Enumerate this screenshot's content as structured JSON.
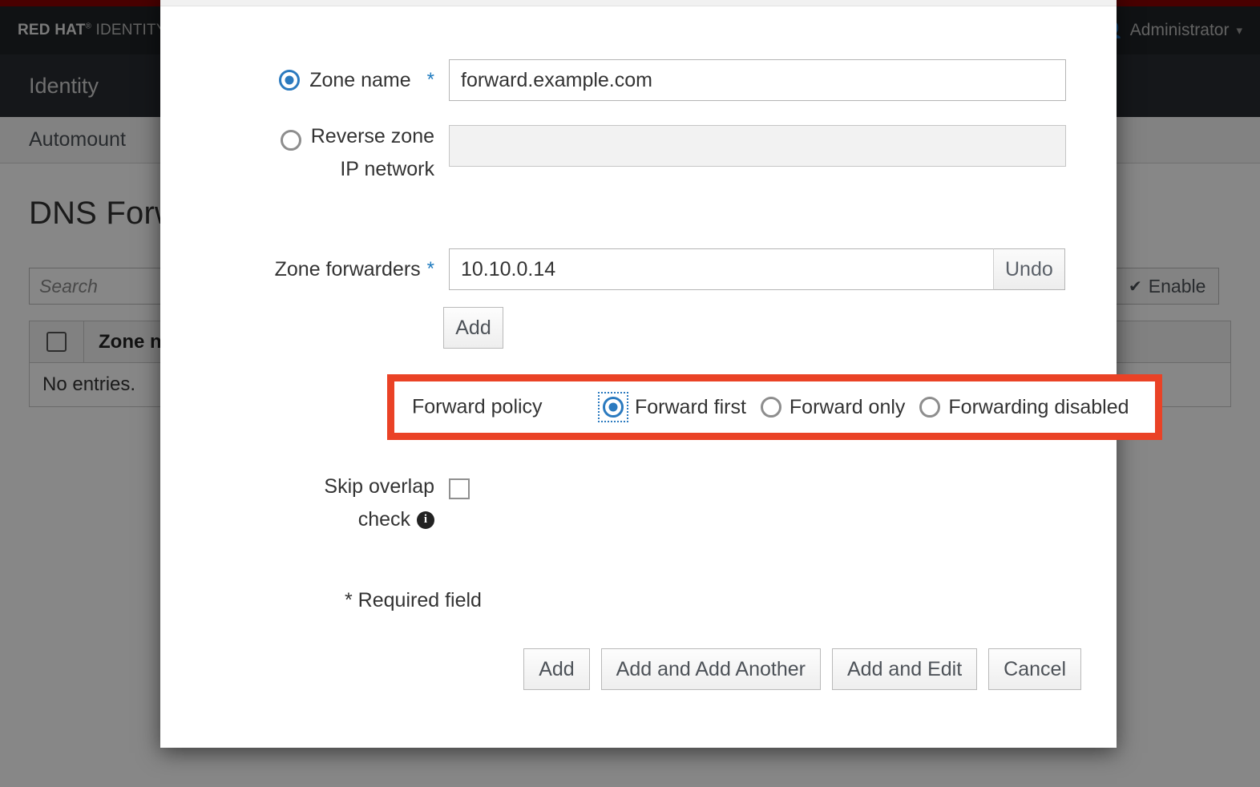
{
  "background": {
    "brand": {
      "red_hat": "RED HAT",
      "sup": "®",
      "product": "IDENTITY MANAGEMENT"
    },
    "masthead": {
      "user_label": "Administrator",
      "user_icon": "user-icon",
      "caret_icon": "chevron-down-icon"
    },
    "nav": {
      "primary": "Identity"
    },
    "subnav": {
      "item": "Automount"
    },
    "page_title": "DNS Forward Zones",
    "search": {
      "placeholder": "Search",
      "value": ""
    },
    "enable_button": {
      "label": "Enable",
      "icon": "check-icon"
    },
    "table": {
      "select_all_icon": "checkbox-icon",
      "columns": [
        "Zone name"
      ],
      "empty_message": "No entries."
    }
  },
  "modal": {
    "zone_name": {
      "label": "Zone name",
      "required_marker": "*",
      "radio_selected": true,
      "value": "forward.example.com"
    },
    "reverse_zone": {
      "label_line1": "Reverse zone",
      "label_line2": "IP network",
      "radio_selected": false,
      "value": "",
      "disabled": true
    },
    "zone_forwarders": {
      "label": "Zone forwarders",
      "required_marker": "*",
      "value": "10.10.0.14",
      "undo_label": "Undo",
      "add_label": "Add"
    },
    "forward_policy": {
      "label": "Forward policy",
      "highlight_color": "#ea4226",
      "options": [
        {
          "label": "Forward first",
          "selected": true,
          "focused": true
        },
        {
          "label": "Forward only",
          "selected": false,
          "focused": false
        },
        {
          "label": "Forwarding disabled",
          "selected": false,
          "focused": false
        }
      ]
    },
    "skip_overlap": {
      "label_line1": "Skip overlap",
      "label_line2": "check",
      "info_icon": "info-icon",
      "info_glyph": "i",
      "checked": false
    },
    "required_note": "* Required field",
    "footer_buttons": [
      "Add",
      "Add and Add Another",
      "Add and Edit",
      "Cancel"
    ]
  }
}
